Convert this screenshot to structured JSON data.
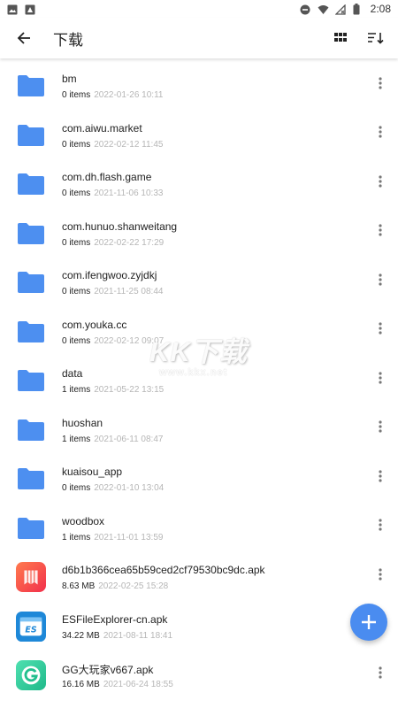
{
  "status_bar": {
    "time": "2:08"
  },
  "app_bar": {
    "title": "下载"
  },
  "files": [
    {
      "type": "folder",
      "name": "bm",
      "count": "0 items",
      "date": "2022-01-26 10:11"
    },
    {
      "type": "folder",
      "name": "com.aiwu.market",
      "count": "0 items",
      "date": "2022-02-12 11:45"
    },
    {
      "type": "folder",
      "name": "com.dh.flash.game",
      "count": "0 items",
      "date": "2021-11-06 10:33"
    },
    {
      "type": "folder",
      "name": "com.hunuo.shanweitang",
      "count": "0 items",
      "date": "2022-02-22 17:29"
    },
    {
      "type": "folder",
      "name": "com.ifengwoo.zyjdkj",
      "count": "0 items",
      "date": "2021-11-25 08:44"
    },
    {
      "type": "folder",
      "name": "com.youka.cc",
      "count": "0 items",
      "date": "2022-02-12 09:07"
    },
    {
      "type": "folder",
      "name": "data",
      "count": "1 items",
      "date": "2021-05-22 13:15"
    },
    {
      "type": "folder",
      "name": "huoshan",
      "count": "1 items",
      "date": "2021-06-11 08:47"
    },
    {
      "type": "folder",
      "name": "kuaisou_app",
      "count": "0 items",
      "date": "2022-01-10 13:04"
    },
    {
      "type": "folder",
      "name": "woodbox",
      "count": "1 items",
      "date": "2021-11-01 13:59"
    },
    {
      "type": "apk",
      "icon": "app-orange",
      "name": "d6b1b366cea65b59ced2cf79530bc9dc.apk",
      "count": "8.63 MB",
      "date": "2022-02-25 15:28"
    },
    {
      "type": "apk",
      "icon": "app-es",
      "name": "ESFileExplorer-cn.apk",
      "count": "34.22 MB",
      "date": "2021-08-11 18:41"
    },
    {
      "type": "apk",
      "icon": "app-gg",
      "name": "GG大玩家v667.apk",
      "count": "16.16 MB",
      "date": "2021-06-24 18:55"
    }
  ],
  "watermark": {
    "main": "KK下载",
    "url": "www.kkx.net"
  },
  "colors": {
    "folder": "#4d8ff0",
    "fab": "#4a8cf0"
  }
}
